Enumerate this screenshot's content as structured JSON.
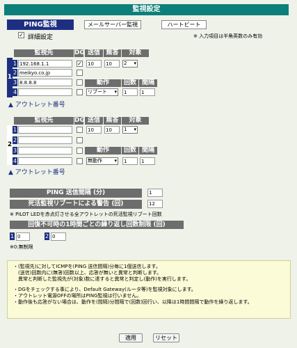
{
  "title": "監視設定",
  "tabs": {
    "active": "PING監視",
    "mail": "メールサーバー監視",
    "heartbeat": "ハートビート"
  },
  "detail_label": "詳細設定",
  "input_note": "※ 入力項目は半角英数のみ有効",
  "headers": {
    "target": "監視先",
    "dg": "DG",
    "send": "送信",
    "noresp": "無答",
    "object": "対象",
    "action": "動作",
    "count": "回数",
    "interval": "間隔"
  },
  "group1": {
    "number": "1",
    "rows": [
      {
        "no": "1",
        "host": "192.168.1.1",
        "dg": true
      },
      {
        "no": "2",
        "host": "meikyo.co.jp",
        "dg": false
      },
      {
        "no": "3",
        "host": "8.8.8.8",
        "dg": false
      },
      {
        "no": "4",
        "host": "",
        "dg": false
      }
    ],
    "send": "10",
    "noresp": "10",
    "object": "2",
    "action": "リブート",
    "count": "1",
    "interval": "1",
    "outlet_link": "▲ アウトレット番号"
  },
  "group2": {
    "number": "2",
    "rows": [
      {
        "no": "1",
        "host": "",
        "dg": false
      },
      {
        "no": "2",
        "host": "",
        "dg": false
      },
      {
        "no": "3",
        "host": "",
        "dg": false
      },
      {
        "no": "4",
        "host": "",
        "dg": false
      }
    ],
    "send": "10",
    "noresp": "10",
    "object": "1",
    "action": "無動作",
    "count": "1",
    "interval": "1",
    "outlet_link": "▲ アウトレット番号"
  },
  "ping_interval": {
    "label": "PING 送信間隔 (分)",
    "value": "1"
  },
  "reboot_warn": {
    "label": "死活監視リブートによる警告 (回)",
    "value": "12",
    "note": "※ PILOT LEDを赤点灯させる全アウトレットの死活監視リブート回数"
  },
  "retry": {
    "label": "回復不可時の1時間ごとの繰り返し回数制限 (回)",
    "g1_no": "1",
    "g1_value": "0",
    "g2_no": "2",
    "g2_value": "0",
    "note": "※0:無制限"
  },
  "notes": [
    "・(監視先)に対してICMPを(PING 送信間隔)分毎に1個送信します。",
    "　(送信)回数内に(無答)回数以上、応答が無いと異常と判断します。",
    "　異常と判断した監視先が(対象)数に達すると異常と判定し(動作)を実行します。",
    "",
    "・DGをチェックする事により、Default Gateway(ルータ等)を監視対象にします。",
    "・アウトレット電源OFFの場所はPING監視は行いません。",
    "・動作後も応答がない場合は、動作を(間隔)分間隔で(回数)回行い、以降は1時間間隔で動作を繰り返します。"
  ],
  "buttons": {
    "apply": "適用",
    "reset": "リセット"
  }
}
